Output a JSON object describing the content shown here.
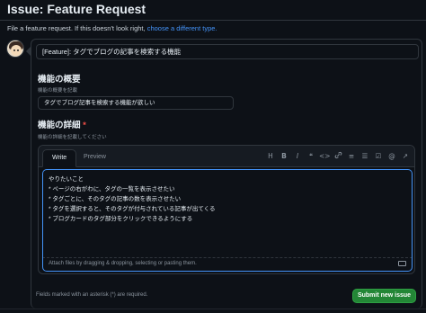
{
  "page": {
    "title": "Issue: Feature Request",
    "subtitle_prefix": "File a feature request. If this doesn't look right, ",
    "subtitle_link": "choose a different type."
  },
  "form": {
    "title_value": "[Feature]: タグでブログの記事を検索する機能",
    "summary": {
      "label": "機能の概要",
      "description": "機能の概要を記載",
      "value": "タグでブログ記事を検索する機能が欲しい"
    },
    "details": {
      "label": "機能の詳細",
      "required_mark": "*",
      "description": "機能の詳細を記載してください",
      "tabs": [
        "Write",
        "Preview"
      ],
      "toolbar_icons": [
        "heading-icon",
        "bold-icon",
        "italic-icon",
        "quote-icon",
        "code-icon",
        "link-icon",
        "numbered-list-icon",
        "bullet-list-icon",
        "task-list-icon",
        "mention-icon",
        "reference-icon"
      ],
      "toolbar_glyphs": [
        "H",
        "B",
        "I",
        "❝",
        "<>",
        "🔗",
        "≡",
        "☰",
        "☑",
        "@",
        "↗"
      ],
      "lines": [
        "やりたいこと",
        "* ページの右がわに、タグの一覧を表示させたい",
        "* タグごとに、そのタグの記事の数を表示させたい",
        "* タグを選択すると、そのタグが付与されている記事が出てくる",
        "* ブログカードのタグ部分をクリックできるようにする"
      ],
      "attach_hint": "Attach files by dragging & dropping, selecting or pasting them."
    },
    "required_note": "Fields marked with an asterisk (*) are required.",
    "submit_label": "Submit new issue"
  },
  "colors": {
    "background": "#0d1117",
    "accent": "#4493f8",
    "submit": "#238636",
    "required": "#f85149"
  }
}
